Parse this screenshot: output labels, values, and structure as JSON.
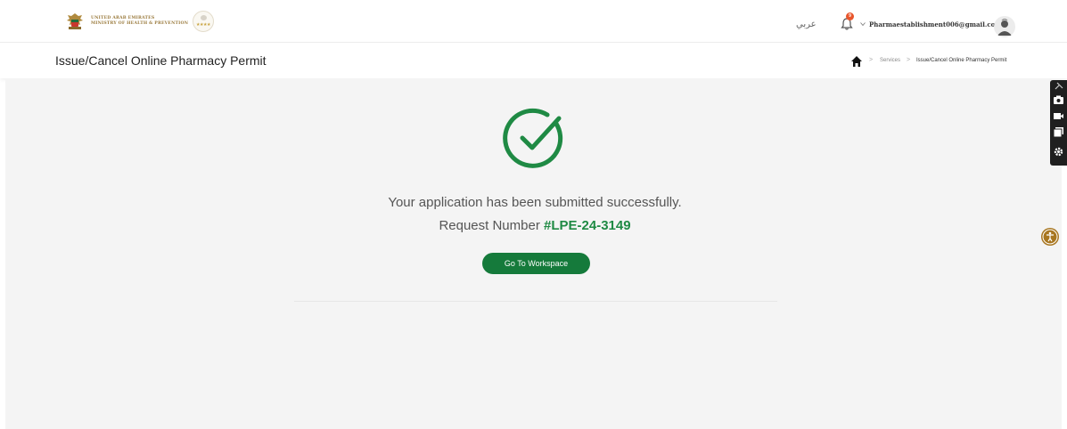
{
  "header": {
    "ministry_line1": "UNITED ARAB EMIRATES",
    "ministry_line2": "MINISTRY OF HEALTH & PREVENTION",
    "rating_stars": "★★★★",
    "language_toggle": "عربي",
    "notification_count": "9",
    "user_email": "Pharmaestablishment006@gmail.com"
  },
  "titlebar": {
    "page_title": "Issue/Cancel Online Pharmacy Permit",
    "breadcrumb": {
      "services": "Services",
      "current": "Issue/Cancel Online Pharmacy Permit",
      "separator": ">"
    }
  },
  "main": {
    "success_message": "Your application has been submitted successfully.",
    "request_label": "Request Number",
    "request_number": "#LPE-24-3149",
    "button_label": "Go To Workspace"
  },
  "colors": {
    "accent_green": "#157a3b",
    "success_green": "#1f8a44",
    "notification_badge": "#e8562c",
    "accessibility_gold": "#a87620"
  },
  "icons": {
    "emblem": "uae-emblem-icon",
    "bell": "bell-icon",
    "avatar": "user-avatar-icon",
    "home": "home-icon",
    "success": "check-circle-icon",
    "tools": [
      "pin-icon",
      "camera-icon",
      "video-icon",
      "window-icon",
      "gear-icon"
    ],
    "accessibility": "accessibility-icon"
  }
}
